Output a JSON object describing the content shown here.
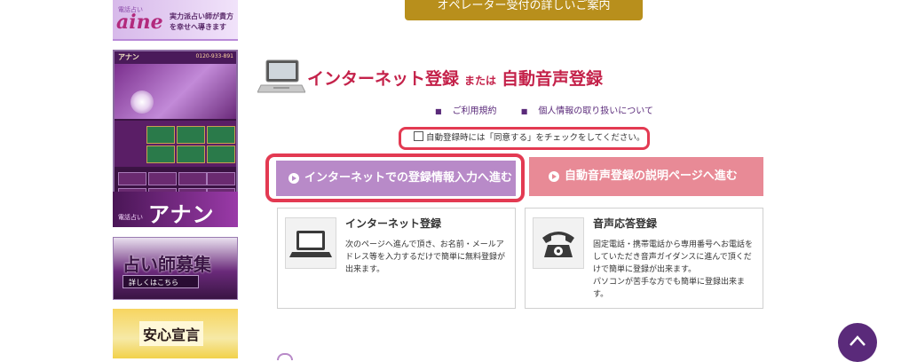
{
  "sidebar": {
    "aine": {
      "logo": "aine",
      "sub": "電話占い",
      "tagline": "実力派占い師が貴方を幸せへ導きます"
    },
    "anan": {
      "title": "アナン",
      "tel": "0120-933-891",
      "label_small": "電話占い",
      "label_big": "アナン"
    },
    "recruit": {
      "title": "占い師募集",
      "button": "詳しくはこちら"
    },
    "safe": {
      "title": "安心宣言"
    }
  },
  "top_button": {
    "label": "オペレーター受付の詳しいご案内"
  },
  "header": {
    "title_main": "インターネット登録",
    "title_or": "または",
    "title_sub": "自動音声登録"
  },
  "links": [
    {
      "label": "ご利用規約"
    },
    {
      "label": "個人情報の取り扱いについて"
    }
  ],
  "agree": {
    "text": "自動登録時には「同意する」をチェックをしてください。",
    "checked": false
  },
  "buttons": {
    "internet": "インターネットでの登録情報入力へ進む",
    "voice": "自動音声登録の説明ページへ進む"
  },
  "cards": {
    "internet": {
      "title": "インターネット登録",
      "text": "次のページへ進んで頂き、お名前・メールアドレス等を入力するだけで簡単に無料登録が出来ます。"
    },
    "voice": {
      "title": "音声応答登録",
      "text1": "固定電話・携帯電話から専用番号へお電話をしていただき音声ガイダンスに進んで頂くだけで簡単に登録が出来ます。",
      "text2": "パソコンが苦手な方でも簡単に登録出来ます。"
    }
  },
  "colors": {
    "accent": "#c4224a",
    "purple": "#5a2a7a",
    "highlight": "#e33a52",
    "btn_purple": "#b88ac8",
    "btn_pink": "#e88a96"
  }
}
